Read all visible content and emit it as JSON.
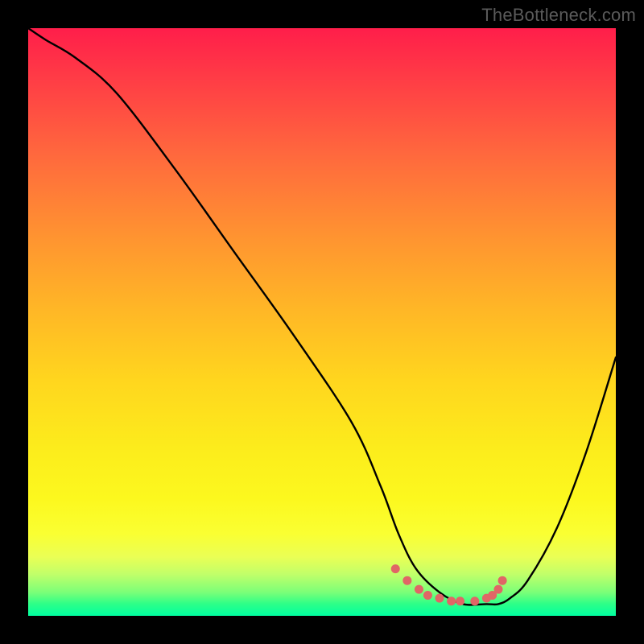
{
  "watermark": "TheBottleneck.com",
  "chart_data": {
    "type": "line",
    "title": "",
    "xlabel": "",
    "ylabel": "",
    "xlim": [
      0,
      100
    ],
    "ylim": [
      0,
      100
    ],
    "series": [
      {
        "name": "curve",
        "x": [
          0,
          3,
          8,
          15,
          25,
          35,
          45,
          55,
          60,
          63,
          66,
          70,
          74,
          78,
          80,
          82,
          85,
          90,
          95,
          100
        ],
        "y": [
          100,
          98,
          95,
          89,
          76,
          62,
          48,
          33,
          22,
          14,
          8,
          4,
          2,
          2,
          2,
          3,
          6,
          15,
          28,
          44
        ]
      }
    ],
    "markers": {
      "name": "dots",
      "x": [
        62.5,
        64.5,
        66.5,
        68.0,
        70.0,
        72.0,
        73.5,
        76.0,
        78.0,
        79.0,
        80.0,
        80.7
      ],
      "y": [
        8.0,
        6.0,
        4.5,
        3.5,
        3.0,
        2.5,
        2.5,
        2.5,
        3.0,
        3.5,
        4.5,
        6.0
      ]
    },
    "gradient_stops": [
      {
        "pos": 0.0,
        "color": "#ff1e4a"
      },
      {
        "pos": 0.08,
        "color": "#ff3a46"
      },
      {
        "pos": 0.22,
        "color": "#ff6a3d"
      },
      {
        "pos": 0.36,
        "color": "#ff9530"
      },
      {
        "pos": 0.48,
        "color": "#ffb726"
      },
      {
        "pos": 0.6,
        "color": "#ffd61e"
      },
      {
        "pos": 0.72,
        "color": "#fced1c"
      },
      {
        "pos": 0.8,
        "color": "#fcf81e"
      },
      {
        "pos": 0.86,
        "color": "#faff32"
      },
      {
        "pos": 0.9,
        "color": "#eaff55"
      },
      {
        "pos": 0.93,
        "color": "#bfff6a"
      },
      {
        "pos": 0.96,
        "color": "#7bff78"
      },
      {
        "pos": 0.98,
        "color": "#2cff88"
      },
      {
        "pos": 1.0,
        "color": "#00ffa0"
      }
    ],
    "marker_color": "#e06666",
    "curve_color": "#000000"
  }
}
